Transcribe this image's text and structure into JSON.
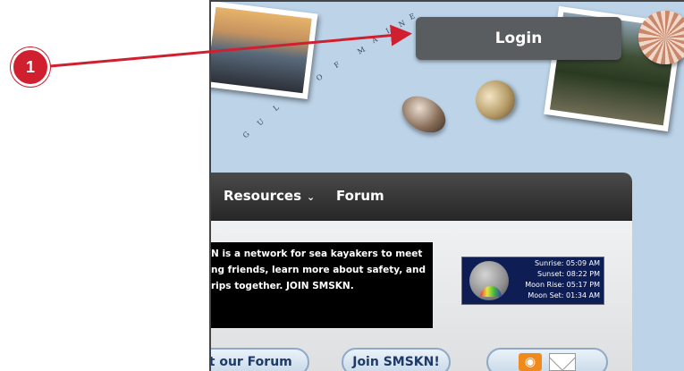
{
  "callout": {
    "number": "1",
    "color": "#d01f2f"
  },
  "header": {
    "gulf_letters": [
      "G",
      "U",
      "L",
      "F",
      "O",
      "F",
      "M",
      "A",
      "I",
      "N",
      "E"
    ],
    "login_label": "Login"
  },
  "nav": {
    "resources_label": "Resources",
    "resources_chevron": "⌄",
    "forum_label": "Forum"
  },
  "mission": {
    "lines": [
      "N is a network for sea kayakers to meet",
      "ng friends, learn more about safety, and",
      "rips together. JOIN SMSKN."
    ]
  },
  "sun_widget": {
    "sunrise": "Sunrise:  05:09 AM",
    "sunset": "Sunset:  08:22 PM",
    "moonrise": "Moon Rise:  05:17 PM",
    "moonset": "Moon Set:  01:34 AM"
  },
  "buttons": {
    "forum_label": "Visit our Forum",
    "join_label": "Join SMSKN!",
    "rss_icon": "rss-icon",
    "mail_icon": "mail-icon"
  }
}
